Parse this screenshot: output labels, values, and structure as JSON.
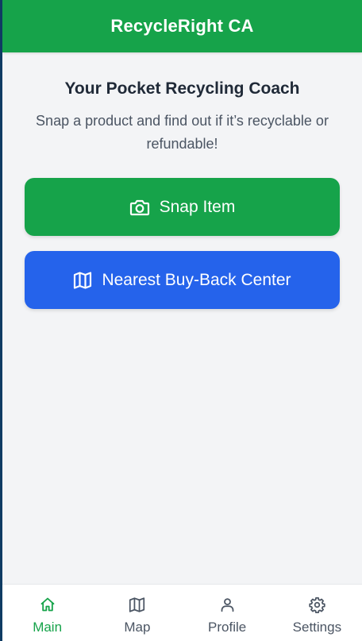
{
  "header": {
    "title": "RecycleRight CA"
  },
  "hero": {
    "title": "Your Pocket Recycling Coach",
    "subtitle": "Snap a product and find out if it’s recyclable or refundable!"
  },
  "actions": {
    "snap_label": "Snap Item",
    "snap_icon": "camera-icon",
    "map_label": "Nearest Buy-Back Center",
    "map_icon": "map-icon"
  },
  "nav": {
    "items": [
      {
        "label": "Main",
        "icon": "home-icon",
        "active": true
      },
      {
        "label": "Map",
        "icon": "map-icon",
        "active": false
      },
      {
        "label": "Profile",
        "icon": "user-icon",
        "active": false
      },
      {
        "label": "Settings",
        "icon": "gear-icon",
        "active": false
      }
    ]
  },
  "colors": {
    "brand_green": "#16a34a",
    "accent_blue": "#2563eb",
    "background": "#f3f4f6",
    "text_dark": "#1f2937",
    "text_muted": "#4b5563"
  }
}
